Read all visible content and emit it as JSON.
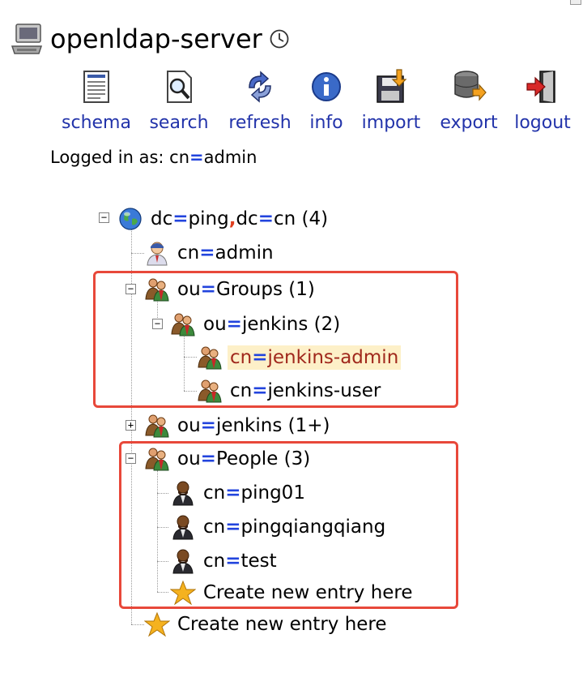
{
  "header": {
    "server_name": "openldap-server",
    "server_icon": "computer-icon",
    "clock_icon": "clock-icon"
  },
  "toolbar": {
    "items": [
      {
        "label": "schema",
        "icon": "schema-document-icon"
      },
      {
        "label": "search",
        "icon": "search-magnifier-icon"
      },
      {
        "label": "refresh",
        "icon": "refresh-arrows-icon"
      },
      {
        "label": "info",
        "icon": "info-icon"
      },
      {
        "label": "import",
        "icon": "import-floppy-icon"
      },
      {
        "label": "export",
        "icon": "export-database-icon"
      },
      {
        "label": "logout",
        "icon": "logout-door-icon"
      }
    ]
  },
  "login": {
    "prefix": "Logged in as: ",
    "attr": "cn",
    "value": "admin"
  },
  "tree": {
    "root": {
      "attr1": "dc",
      "val1": "ping",
      "attr2": "dc",
      "val2": "cn",
      "count": " (4)"
    },
    "admin": {
      "attr": "cn",
      "value": "admin"
    },
    "groups": {
      "attr": "ou",
      "value": "Groups",
      "count": " (1)"
    },
    "jenkins_group": {
      "attr": "ou",
      "value": "jenkins",
      "count": " (2)"
    },
    "jenkins_admin": {
      "attr": "cn",
      "value": "jenkins-admin"
    },
    "jenkins_user": {
      "attr": "cn",
      "value": "jenkins-user"
    },
    "ou_jenkins": {
      "attr": "ou",
      "value": "jenkins",
      "count": " (1+)"
    },
    "people": {
      "attr": "ou",
      "value": "People",
      "count": " (3)"
    },
    "ping01": {
      "attr": "cn",
      "value": "ping01"
    },
    "pingqiangqiang": {
      "attr": "cn",
      "value": "pingqiangqiang"
    },
    "test": {
      "attr": "cn",
      "value": "test"
    },
    "create_in_people": "Create new entry here",
    "create_in_root": "Create new entry here",
    "toggle_minus": "−",
    "toggle_plus": "+"
  },
  "colors": {
    "link": "#2233aa",
    "equals": "#2244dd",
    "comma": "#e04020",
    "selected_bg": "#fdf0c8",
    "selected_text": "#a0281c",
    "highlight_box": "#e8483a"
  }
}
